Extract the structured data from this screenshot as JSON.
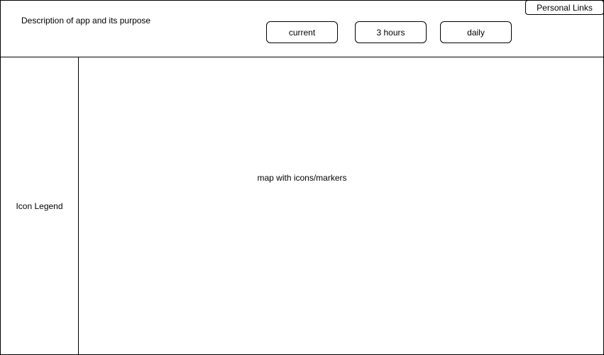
{
  "header": {
    "description": "Description of app and its purpose",
    "buttons": {
      "current": "current",
      "three_hours": "3 hours",
      "daily": "daily"
    },
    "personal_links": "Personal Links"
  },
  "sidebar": {
    "label": "Icon Legend"
  },
  "map": {
    "label": "map with icons/markers"
  }
}
